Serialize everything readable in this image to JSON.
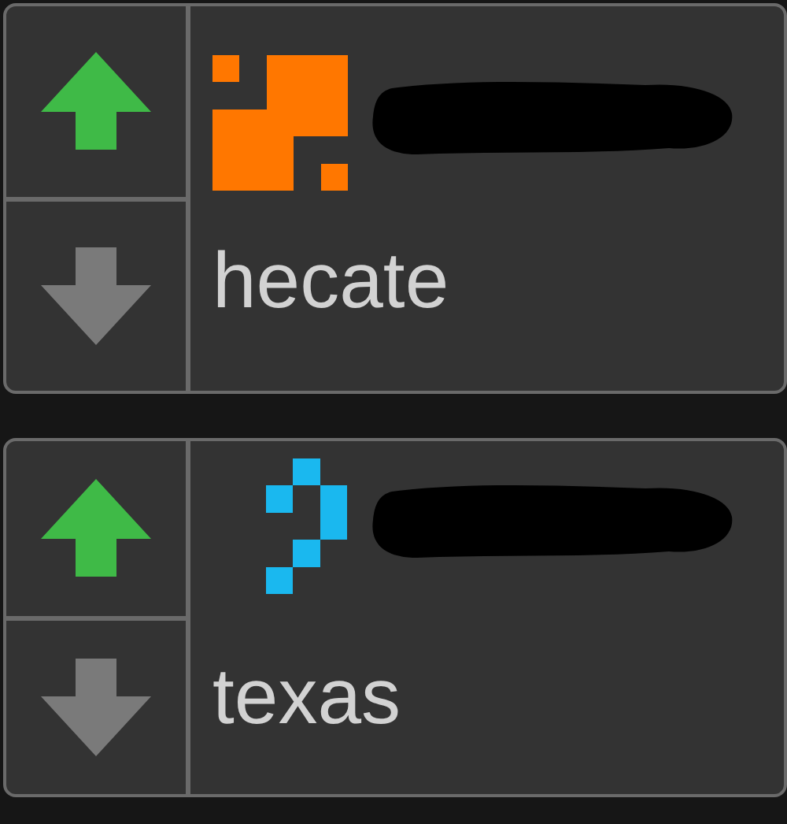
{
  "comments": [
    {
      "upvoted": true,
      "downvoted": false,
      "color": "#ff7700",
      "text": "hecate"
    },
    {
      "upvoted": true,
      "downvoted": false,
      "color": "#1ab8ef",
      "text": "texas"
    }
  ]
}
